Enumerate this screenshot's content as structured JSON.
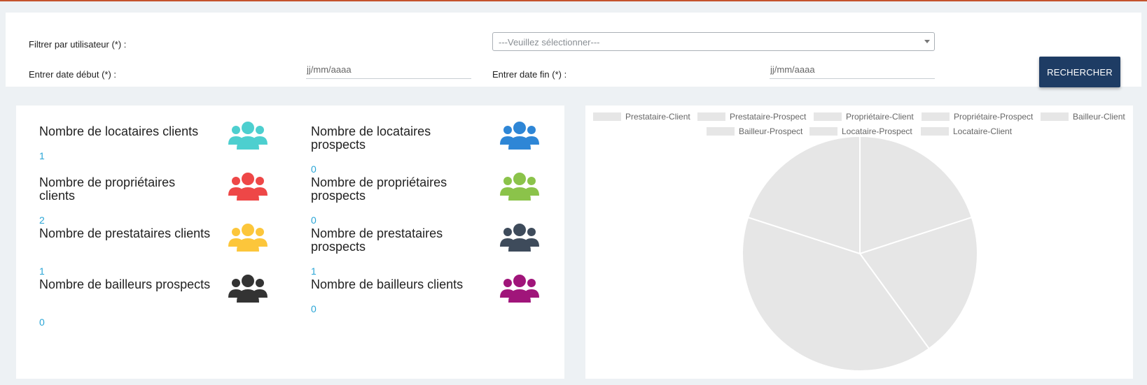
{
  "filters": {
    "user_label": "Filtrer par utilisateur (*) :",
    "user_select_value": "---Veuillez sélectionner---",
    "start_label": "Entrer date début (*) :",
    "start_placeholder": "jj/mm/aaaa",
    "end_label": "Entrer date fin (*) :",
    "end_placeholder": "jj/mm/aaaa",
    "search_label": "RECHERCHER"
  },
  "stats": [
    {
      "title": "Nombre de locataires clients",
      "value": "1",
      "icon": "users-icon",
      "color": "#4dcfcf"
    },
    {
      "title": "Nombre de locataires prospects",
      "value": "0",
      "icon": "users-icon",
      "color": "#2e86d6"
    },
    {
      "title": "Nombre de propriétaires clients",
      "value": "2",
      "icon": "users-icon",
      "color": "#ee4747"
    },
    {
      "title": "Nombre de propriétaires prospects",
      "value": "0",
      "icon": "users-icon",
      "color": "#8bc34a"
    },
    {
      "title": "Nombre de prestataires clients",
      "value": "1",
      "icon": "users-icon",
      "color": "#fcc63b"
    },
    {
      "title": "Nombre de prestataires prospects",
      "value": "1",
      "icon": "users-icon",
      "color": "#3e4b5b"
    },
    {
      "title": "Nombre de bailleurs prospects",
      "value": "0",
      "icon": "users-icon",
      "color": "#333333"
    },
    {
      "title": "Nombre de bailleurs clients",
      "value": "0",
      "icon": "users-icon",
      "color": "#a0157a"
    }
  ],
  "chart_data": {
    "type": "pie",
    "categories": [
      "Prestataire-Client",
      "Prestataire-Prospect",
      "Propriétaire-Client",
      "Propriétaire-Prospect",
      "Bailleur-Client",
      "Bailleur-Prospect",
      "Locataire-Prospect",
      "Locataire-Client"
    ],
    "values": [
      1,
      1,
      2,
      0,
      0,
      0,
      0,
      1
    ],
    "colors": [
      "#e6e6e6",
      "#e6e6e6",
      "#e6e6e6",
      "#e6e6e6",
      "#e6e6e6",
      "#e6e6e6",
      "#e6e6e6",
      "#e6e6e6"
    ],
    "legend": "top"
  }
}
